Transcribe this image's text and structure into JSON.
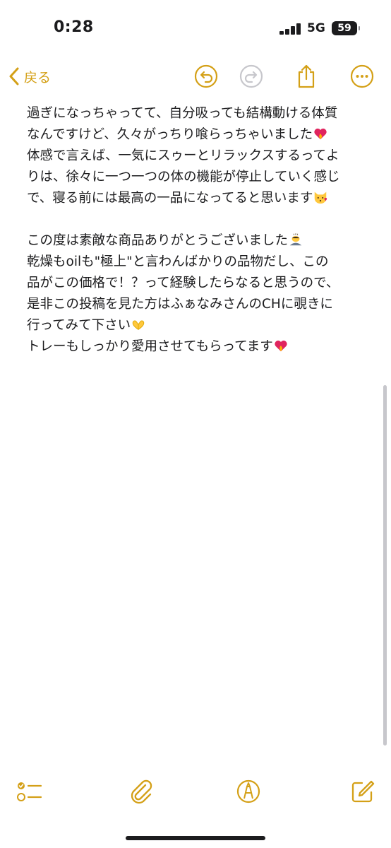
{
  "status_bar": {
    "time": "0:28",
    "network": "5G",
    "battery": "59"
  },
  "nav": {
    "back_label": "戻る"
  },
  "note": {
    "lines_a": [
      "過ぎになっちゃってて、自分吸っても結構動ける体質",
      "なんですけど、久々がっちり喰らっちゃいました",
      "体感で言えば、一気にスゥーとリラックスするってよ",
      "りは、徐々に一つ一つの体の機能が停止していく感じ",
      "で、寝る前には最高の一品になってると思います"
    ],
    "lines_b": [
      "この度は素敵な商品ありがとうございました",
      "乾燥もoilも\"極上\"と言わんばかりの品物だし、この",
      "品がこの価格で！？って経験したらなると思うので、",
      "是非この投稿を見た方はふぁなみさんのCHに覗きに",
      "行ってみて下さい",
      "トレーもしっかり愛用させてもらってます"
    ]
  },
  "colors": {
    "accent": "#d4a017",
    "text": "#1c1c1e",
    "background": "#ffffff"
  },
  "icons": {
    "nav": [
      "chevron-left-icon",
      "undo-icon",
      "redo-icon",
      "share-icon",
      "more-icon"
    ],
    "toolbar": [
      "checklist-icon",
      "paperclip-icon",
      "markup-pen-icon",
      "compose-icon"
    ],
    "emoji": [
      "heart-on-fire-emoji",
      "kissing-cat-emoji",
      "bowing-person-emoji",
      "heart-hands-emoji"
    ]
  }
}
